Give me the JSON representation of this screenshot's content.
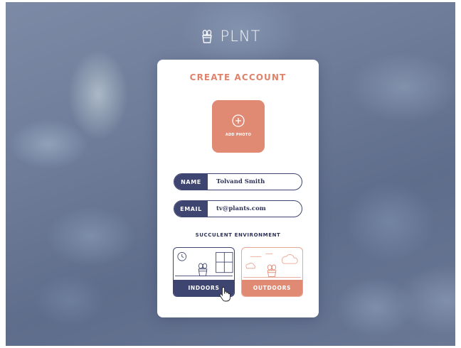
{
  "app": {
    "logo_text": "PLNT"
  },
  "card": {
    "title": "CREATE ACCOUNT",
    "add_photo_label": "ADD PHOTO",
    "fields": {
      "name": {
        "label": "NAME",
        "value": "Tolvand Smith"
      },
      "email": {
        "label": "EMAIL",
        "value": "tv@plants.com"
      }
    },
    "environment": {
      "label": "SUCCULENT ENVIRONMENT",
      "options": [
        {
          "label": "INDOORS",
          "selected": true
        },
        {
          "label": "OUTDOORS",
          "selected": false
        }
      ]
    }
  },
  "icons": {
    "logo": "potted-plant-icon",
    "add_photo": "plus-circle-icon",
    "cursor": "hand-pointer-icon"
  },
  "colors": {
    "navy": "#3e4570",
    "coral": "#e08a74",
    "card": "#ffffff"
  }
}
